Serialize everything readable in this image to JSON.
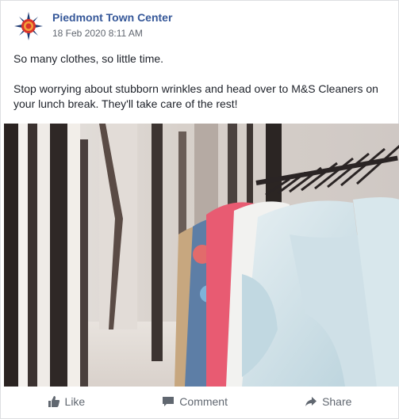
{
  "post": {
    "page_name": "Piedmont Town Center",
    "timestamp": "18 Feb 2020 8:11 AM",
    "text_line1": "So many clothes, so little time.",
    "text_line2": "Stop worrying about stubborn wrinkles and head over to M&S Cleaners on your lunch break. They'll take care of the rest!",
    "avatar_icon": "compass-logo-icon",
    "image_icon": "clothing-rack-photo"
  },
  "actions": {
    "like_label": "Like",
    "comment_label": "Comment",
    "share_label": "Share"
  },
  "colors": {
    "link": "#365899",
    "meta": "#616770",
    "action": "#606770",
    "logo_red": "#d9342b",
    "logo_blue": "#1f3b73"
  }
}
